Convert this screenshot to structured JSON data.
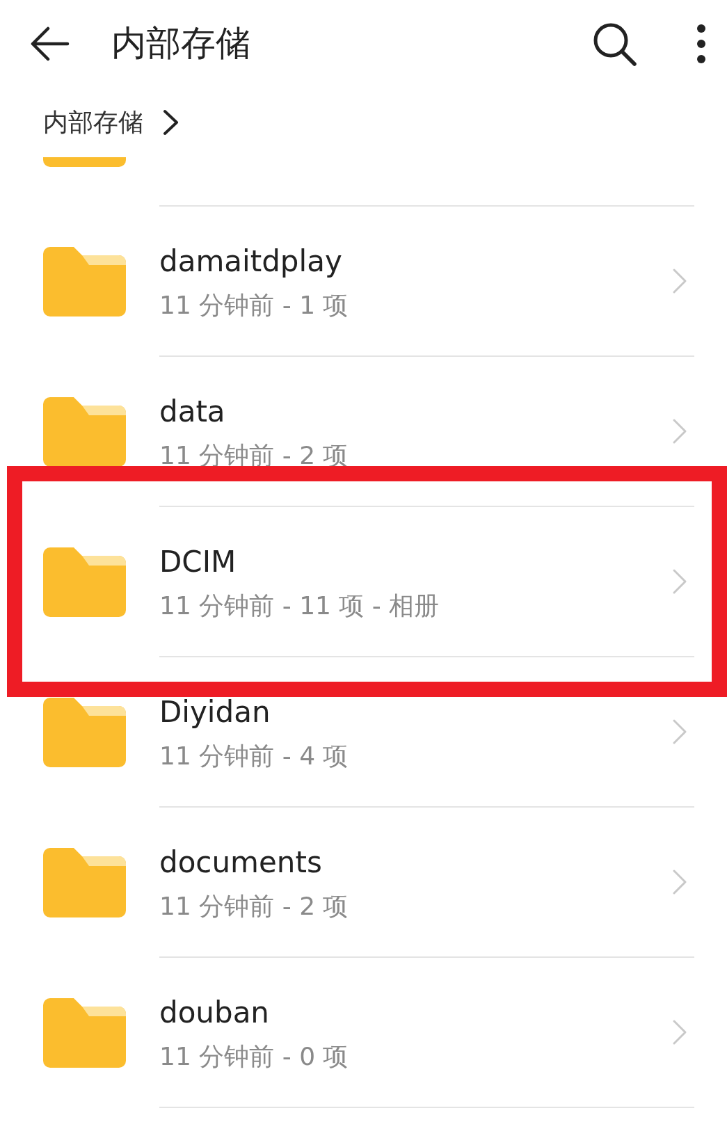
{
  "header": {
    "title": "内部存储"
  },
  "breadcrumb": [
    {
      "label": "内部存储"
    }
  ],
  "rows": [
    {
      "kind": "cut_off"
    },
    {
      "kind": "folder",
      "name": "damaitdplay",
      "meta": "11 分钟前 - 1 项",
      "highlighted": false
    },
    {
      "kind": "folder",
      "name": "data",
      "meta": "11 分钟前 - 2 项",
      "highlighted": false
    },
    {
      "kind": "folder",
      "name": "DCIM",
      "meta": "11 分钟前 - 11 项 - 相册",
      "highlighted": true
    },
    {
      "kind": "folder",
      "name": "Diyidan",
      "meta": "11 分钟前 - 4 项",
      "highlighted": false
    },
    {
      "kind": "folder",
      "name": "documents",
      "meta": "11 分钟前 - 2 项",
      "highlighted": false
    },
    {
      "kind": "folder",
      "name": "douban",
      "meta": "11 分钟前 - 0 项",
      "highlighted": false
    }
  ]
}
